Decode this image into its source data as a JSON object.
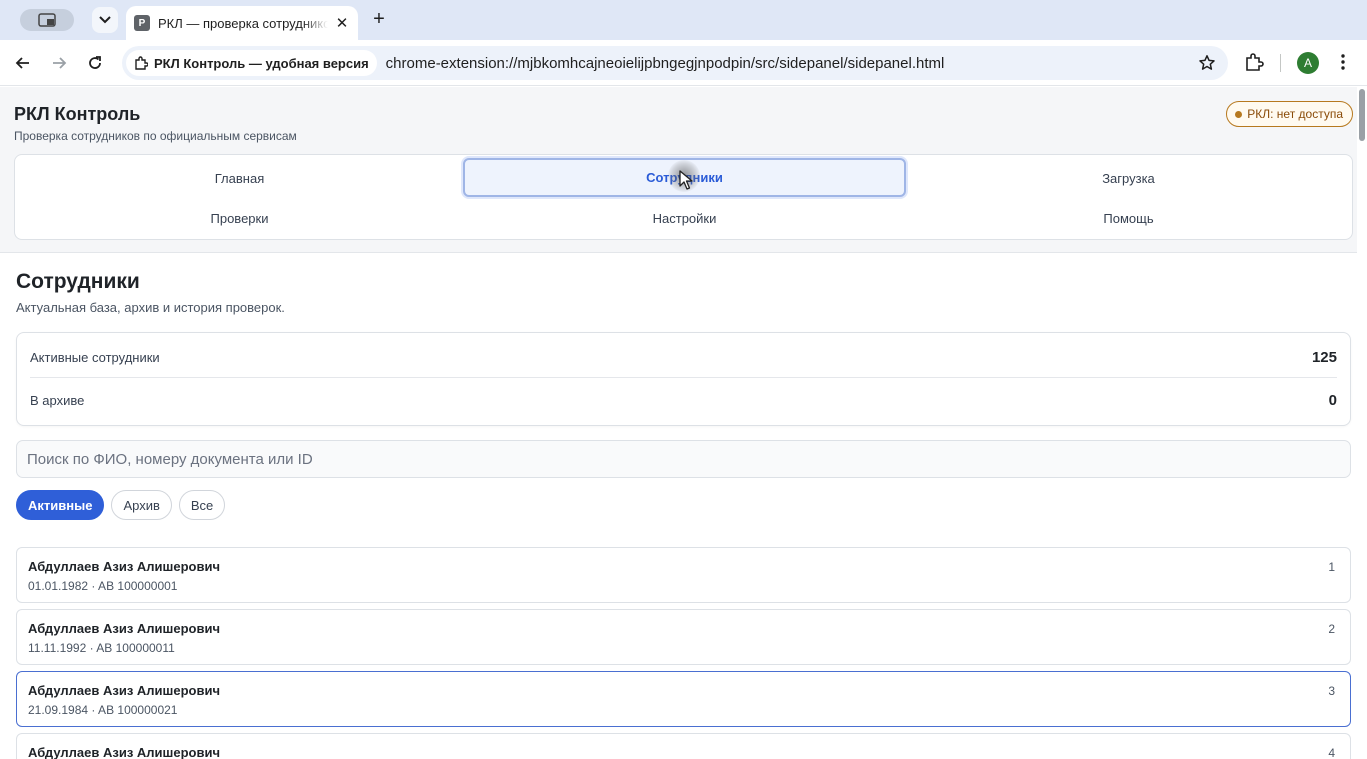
{
  "browser": {
    "tab_title": "РКЛ — проверка сотрудников",
    "tab_favicon_letter": "Р",
    "site_chip_label": "РКЛ Контроль — удобная версия",
    "url": "chrome-extension://mjbkomhcajneoielijpbngegjnpodpin/src/sidepanel/sidepanel.html",
    "profile_initial": "A"
  },
  "app": {
    "title": "РКЛ Контроль",
    "subtitle": "Проверка сотрудников по официальным сервисам",
    "status_badge": "РКЛ: нет доступа",
    "nav": {
      "home": "Главная",
      "employees": "Сотрудники",
      "upload": "Загрузка",
      "checks": "Проверки",
      "settings": "Настройки",
      "help": "Помощь"
    }
  },
  "employees_section": {
    "title": "Сотрудники",
    "subtitle": "Актуальная база, архив и история проверок.",
    "stats": {
      "active_label": "Активные сотрудники",
      "active_value": "125",
      "archived_label": "В архиве",
      "archived_value": "0"
    },
    "search_placeholder": "Поиск по ФИО, номеру документа или ID",
    "filters": {
      "active": "Активные",
      "archive": "Архив",
      "all": "Все"
    },
    "list": [
      {
        "name": "Абдуллаев Азиз Алишерович",
        "meta": "01.01.1982 · AB 100000001",
        "num": "1"
      },
      {
        "name": "Абдуллаев Азиз Алишерович",
        "meta": "11.11.1992 · AB 100000011",
        "num": "2"
      },
      {
        "name": "Абдуллаев Азиз Алишерович",
        "meta": "21.09.1984 · AB 100000021",
        "num": "3"
      },
      {
        "name": "Абдуллаев Азиз Алишерович",
        "meta": "",
        "num": "4"
      }
    ]
  }
}
